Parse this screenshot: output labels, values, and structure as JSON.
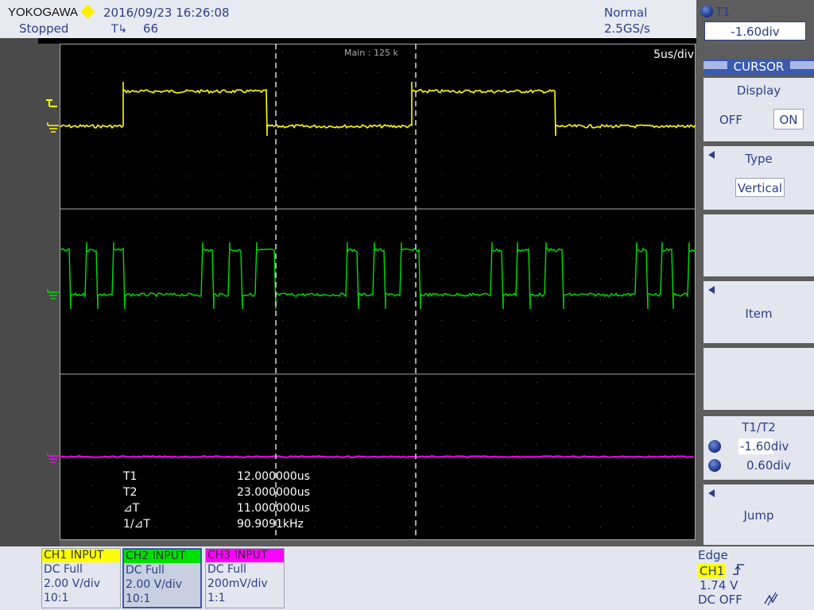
{
  "header": {
    "brand": "YOKOGAWA",
    "datetime": "2016/09/23 16:26:08",
    "run_state": "Stopped",
    "trig_icon": "T↳",
    "count": "66",
    "mode": "Normal",
    "sample_rate": "2.5GS/s"
  },
  "scope": {
    "main_label": "Main : 125 k",
    "time_div": "5us/div",
    "measurements": [
      {
        "label": "T1",
        "value": "12.000000us"
      },
      {
        "label": "T2",
        "value": "23.000000us"
      },
      {
        "label": "⊿T",
        "value": "11.000000us"
      },
      {
        "label": "1/⊿T",
        "value": "90.9091kHz"
      }
    ]
  },
  "menu": {
    "t1_label": "T1",
    "t1_value": "-1.60div",
    "section_title": "CURSOR",
    "display_title": "Display",
    "display_off": "OFF",
    "display_on": "ON",
    "type_title": "Type",
    "type_value": "Vertical",
    "item_label": "Item",
    "t1t2_title": "T1/T2",
    "t1_pos": "-1.60div",
    "t2_pos": "0.60div",
    "jump_label": "Jump"
  },
  "channels": [
    {
      "name": "CH1 INPUT",
      "coupling": "DC Full",
      "scale": "2.00 V/div",
      "probe": "10:1",
      "color": "#ffff00"
    },
    {
      "name": "CH2 INPUT",
      "coupling": "DC Full",
      "scale": "2.00 V/div",
      "probe": "10:1",
      "color": "#00e000"
    },
    {
      "name": "CH3 INPUT",
      "coupling": "DC Full",
      "scale": "200mV/div",
      "probe": "1:1",
      "color": "#ff00ff"
    }
  ],
  "trigger": {
    "type": "Edge",
    "source": "CH1",
    "level": "1.74 V",
    "coupling": "DC OFF"
  },
  "colors": {
    "ch1": "#ffff00",
    "ch2": "#00e000",
    "ch3": "#ff00ff",
    "accent": "#2b3f8a",
    "panel": "#e3e6ee"
  },
  "icons": {
    "run_state_diamond": "diamond-icon",
    "trigger_edge": "rising-edge-icon",
    "cursor_knob": "knob-icon"
  }
}
